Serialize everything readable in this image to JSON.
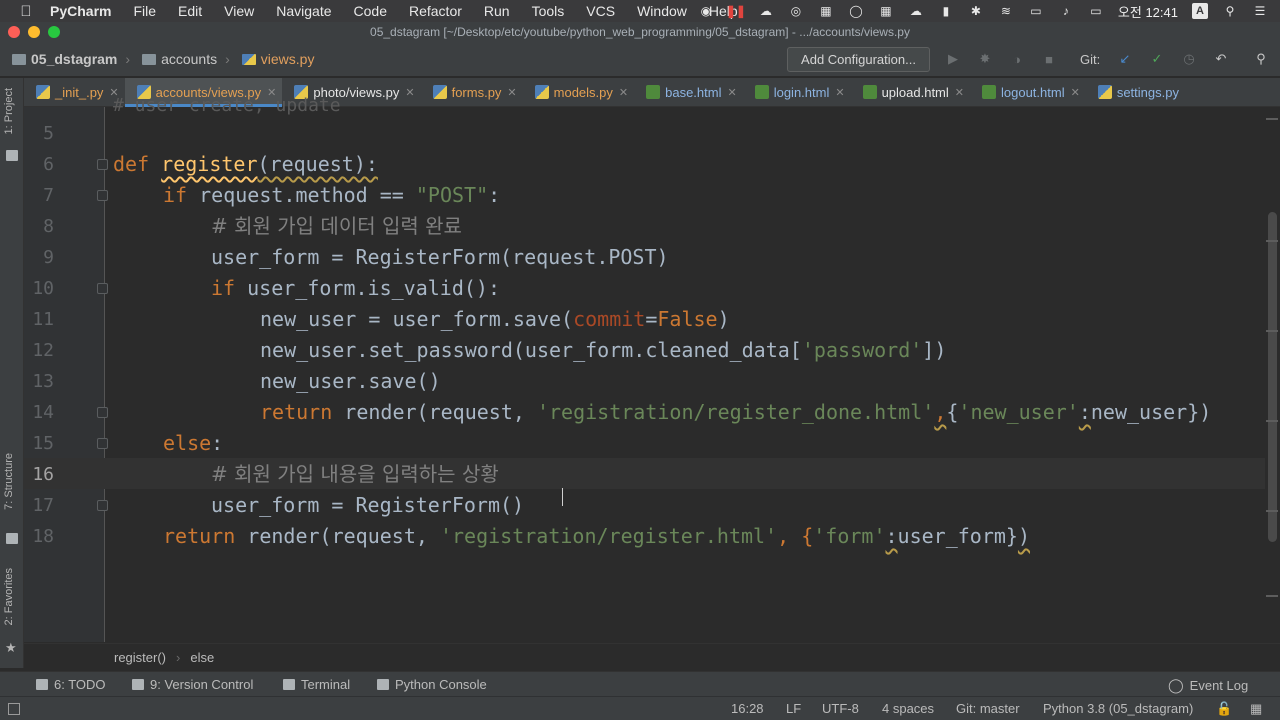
{
  "menubar": {
    "app": "PyCharm",
    "items": [
      "File",
      "Edit",
      "View",
      "Navigate",
      "Code",
      "Refactor",
      "Run",
      "Tools",
      "VCS",
      "Window",
      "Help"
    ],
    "clock": "오전 12:41",
    "ime": "A"
  },
  "window": {
    "title": "05_dstagram [~/Desktop/etc/youtube/python_web_programming/05_dstagram] - .../accounts/views.py"
  },
  "navbar": {
    "project": "05_dstagram",
    "folder": "accounts",
    "file": "views.py",
    "add_config": "Add Configuration...",
    "git_label": "Git:"
  },
  "tabs": [
    {
      "label": "_init_.py"
    },
    {
      "label": "accounts/views.py"
    },
    {
      "label": "photo/views.py"
    },
    {
      "label": "forms.py"
    },
    {
      "label": "models.py"
    },
    {
      "label": "base.html"
    },
    {
      "label": "login.html"
    },
    {
      "label": "upload.html"
    },
    {
      "label": "logout.html"
    },
    {
      "label": "settings.py"
    }
  ],
  "left_tools": {
    "project": "1: Project",
    "structure": "7: Structure",
    "favorites": "2: Favorites"
  },
  "code": {
    "line_numbers": [
      "5",
      "6",
      "7",
      "8",
      "9",
      "10",
      "11",
      "12",
      "13",
      "14",
      "15",
      "16",
      "17",
      "18"
    ],
    "current_line": "16",
    "partial_top": "# user create, update",
    "l6_def": "def ",
    "l6_fn": "register",
    "l6_rest": "(request):",
    "l7_if": "if ",
    "l7_mid": "request.method == ",
    "l7_str": "\"POST\"",
    "l7_end": ":",
    "l8_cmt": "# 회원 가입 데이터 입력 완료",
    "l9": "user_form = RegisterForm(request.POST)",
    "l10_if": "if ",
    "l10_rest": "user_form.is_valid():",
    "l11_a": "new_user = user_form.save(",
    "l11_param": "commit",
    "l11_eq": "=",
    "l11_false": "False",
    "l11_end": ")",
    "l12_a": "new_user.set_password(user_form.cleaned_data[",
    "l12_str": "'password'",
    "l12_end": "])",
    "l13": "new_user.save()",
    "l14_ret": "return ",
    "l14_a": "render(request, ",
    "l14_str": "'registration/register_done.html'",
    "l14_comma": ",",
    "l14_brace": "{",
    "l14_key": "'new_user'",
    "l14_colon": ":",
    "l14_end": "new_user})",
    "l15_else": "else",
    "l15_colon": ":",
    "l16_cmt": "# 회원 가입 내용을 입력하는 상황",
    "l17": "user_form = RegisterForm()",
    "l18_ret": "return ",
    "l18_a": "render(request, ",
    "l18_str": "'registration/register.html'",
    "l18_b": ", {",
    "l18_key": "'form'",
    "l18_colon": ":",
    "l18_c": "user_form}",
    "l18_end": ")"
  },
  "code_crumbs": [
    "register()",
    "else"
  ],
  "toolwindows": {
    "todo": "6: TODO",
    "vcs": "9: Version Control",
    "terminal": "Terminal",
    "console": "Python Console",
    "eventlog": "Event Log"
  },
  "status": {
    "position": "16:28",
    "line_sep": "LF",
    "encoding": "UTF-8",
    "indent": "4 spaces",
    "git": "Git: master",
    "interpreter": "Python 3.8 (05_dstagram)"
  },
  "colors": {
    "keyword": "#cc7832",
    "string": "#6a8759",
    "comment": "#808080",
    "function": "#ffc66d",
    "accent": "#4a88c7"
  }
}
